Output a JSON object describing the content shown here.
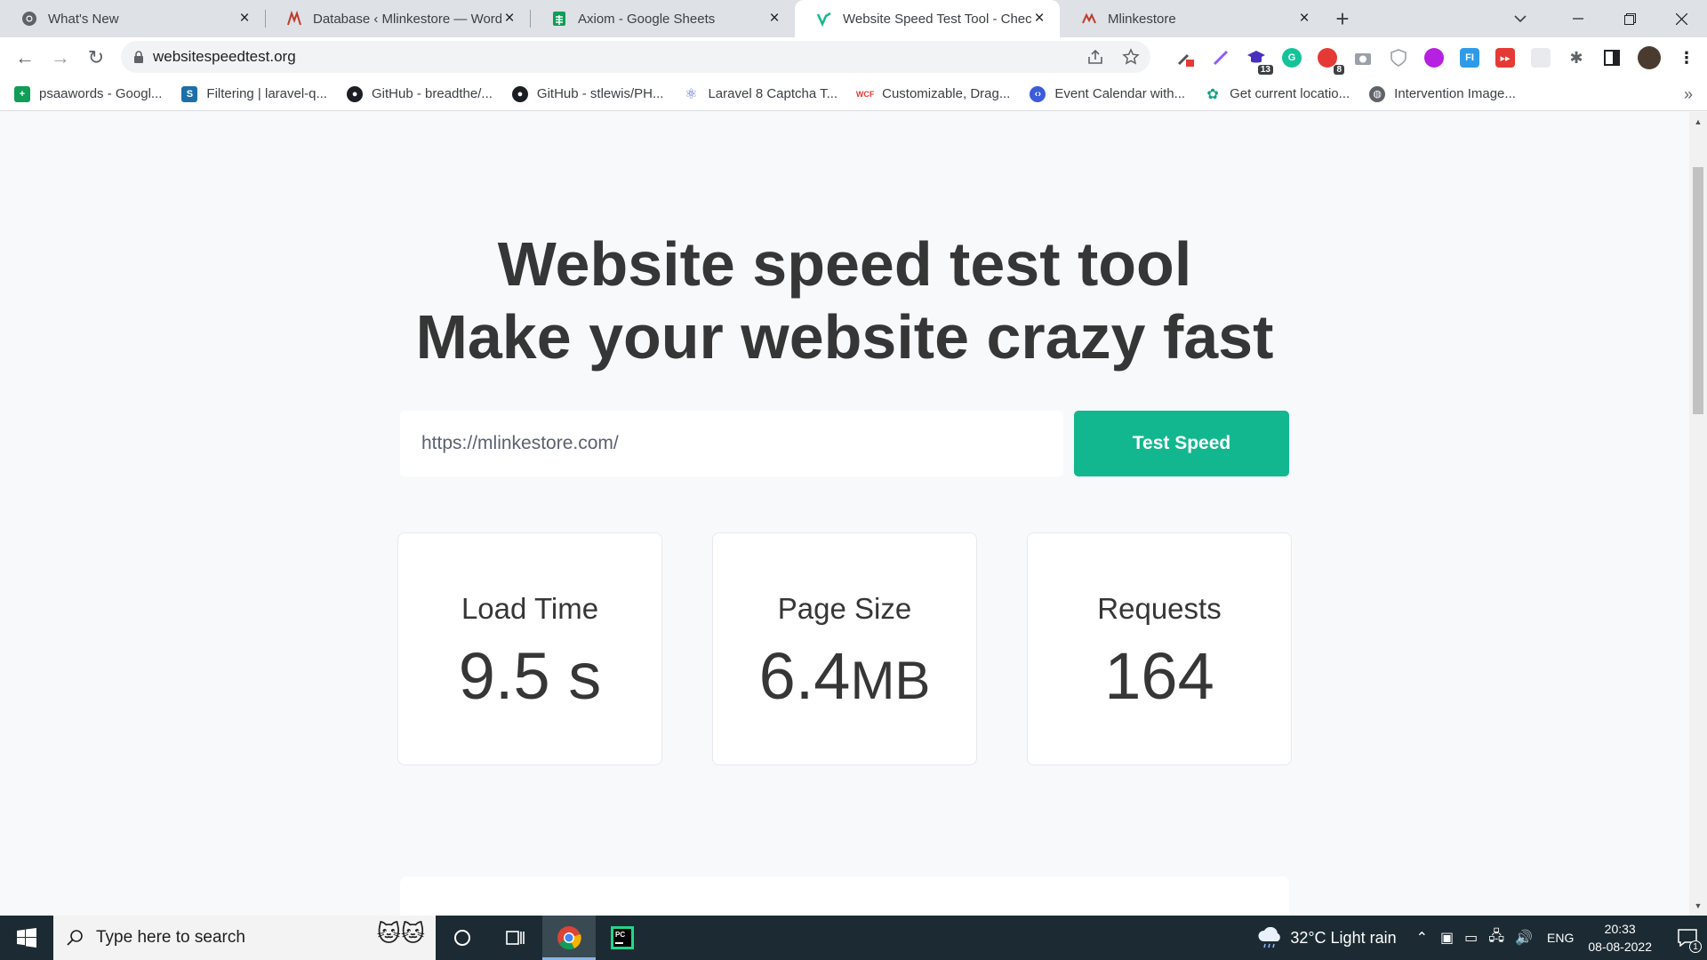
{
  "tabs": [
    {
      "title": "What's New",
      "active": false
    },
    {
      "title": "Database ‹ Mlinkestore — WordPress",
      "active": false
    },
    {
      "title": "Axiom - Google Sheets",
      "active": false
    },
    {
      "title": "Website Speed Test Tool - Check",
      "active": true
    },
    {
      "title": "Mlinkestore",
      "active": false
    }
  ],
  "address_bar": {
    "url": "websitespeedtest.org"
  },
  "extensions": {
    "badge_a": "13",
    "badge_b": "8"
  },
  "bookmarks": [
    {
      "label": "psaawords - Googl...",
      "icon": "sheets-icon"
    },
    {
      "label": "Filtering | laravel-q...",
      "icon": "s-icon"
    },
    {
      "label": "GitHub - breadthe/...",
      "icon": "github-icon"
    },
    {
      "label": "GitHub - stlewis/PH...",
      "icon": "github-icon"
    },
    {
      "label": "Laravel 8 Captcha T...",
      "icon": "react-icon"
    },
    {
      "label": "Customizable, Drag...",
      "icon": "wcf-icon"
    },
    {
      "label": "Event Calendar with...",
      "icon": "code-icon"
    },
    {
      "label": "Get current locatio...",
      "icon": "openai-icon"
    },
    {
      "label": "Intervention Image...",
      "icon": "globe-icon"
    }
  ],
  "page": {
    "heading_line1": "Website speed test tool",
    "heading_line2": "Make your website crazy fast",
    "url_placeholder": "https://mlinkestore.com/",
    "test_button": "Test Speed",
    "metrics": [
      {
        "label": "Load Time",
        "value": "9.5 s",
        "unit": ""
      },
      {
        "label": "Page Size",
        "value": "6.4",
        "unit": "MB"
      },
      {
        "label": "Requests",
        "value": "164",
        "unit": ""
      }
    ]
  },
  "taskbar": {
    "search_placeholder": "Type here to search",
    "weather": "32°C  Light rain",
    "language": "ENG",
    "time": "20:33",
    "date": "08-08-2022",
    "notifications": "1"
  },
  "colors": {
    "accent": "#13b78f",
    "page_bg": "#f7f9fb",
    "text": "#363636"
  }
}
